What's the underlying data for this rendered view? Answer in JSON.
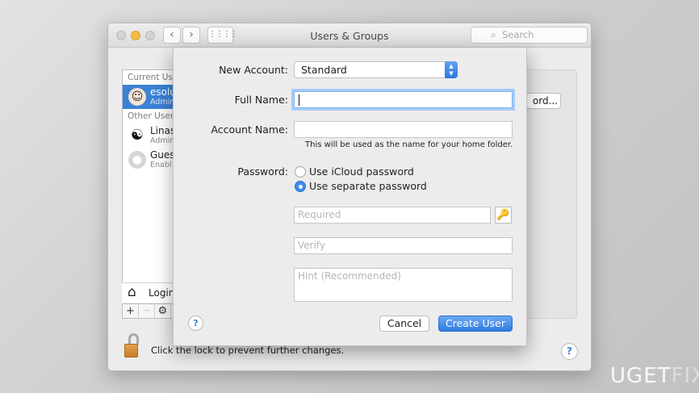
{
  "window": {
    "title": "Users & Groups",
    "search_placeholder": "Search",
    "nav_back": "‹",
    "nav_forward": "›",
    "grid": "⋮⋮⋮⋮"
  },
  "user_list": {
    "current_users_header": "Current Use",
    "current_user": {
      "name": "esolu",
      "role": "Admin"
    },
    "other_users_header": "Other Users",
    "other_users": [
      {
        "name": "Linas",
        "role": "Admin"
      },
      {
        "name": "Gues",
        "role": "Enabl"
      }
    ],
    "login_label": "Login",
    "add_label": "+",
    "remove_label": "—",
    "gear_label": "⚙"
  },
  "main": {
    "password_button": "ord...",
    "lock_text": "Click the lock to prevent further changes.",
    "help": "?"
  },
  "sheet": {
    "new_account_label": "New Account:",
    "new_account_value": "Standard",
    "full_name_label": "Full Name:",
    "full_name_value": "",
    "account_name_label": "Account Name:",
    "account_name_value": "",
    "account_name_hint": "This will be used as the name for your home folder.",
    "password_label": "Password:",
    "radio_icloud": "Use iCloud password",
    "radio_separate": "Use separate password",
    "selected_password_option": "separate",
    "required_placeholder": "Required",
    "verify_placeholder": "Verify",
    "hint_placeholder": "Hint (Recommended)",
    "key_icon": "🔑",
    "help": "?",
    "cancel_label": "Cancel",
    "create_label": "Create User"
  },
  "watermark": {
    "prefix": "UG",
    "mid": "ET",
    "suffix": "FIX"
  },
  "colors": {
    "accent": "#3b82d6",
    "button_primary": "#2f7be0",
    "lock": "#d08a35"
  }
}
